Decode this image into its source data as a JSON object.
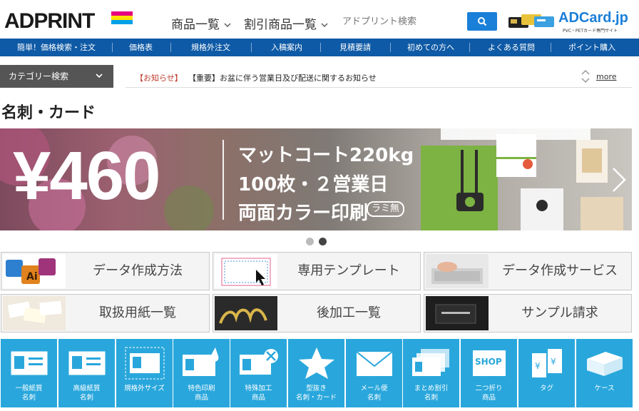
{
  "header": {
    "logo_text": "ADPRINT",
    "nav": [
      {
        "label": "商品一覧"
      },
      {
        "label": "割引商品一覧"
      }
    ],
    "search_placeholder": "アドプリント検索",
    "adcard_title": "ADCard.jp",
    "adcard_sub": "PVC・PETカード専門サイト",
    "logo_colors": [
      "#e6007e",
      "#ffe100",
      "#00a0e9"
    ]
  },
  "bluebar": {
    "items": [
      "簡単！価格検索・注文",
      "価格表",
      "規格外注文",
      "入稿案内",
      "見積要請",
      "初めての方へ",
      "よくある質問",
      "ポイント購入"
    ]
  },
  "category_search": "カテゴリー検索",
  "news": {
    "label": "【お知らせ】",
    "text": "【重要】お盆に伴う営業日及び配送に関するお知らせ",
    "more": "more"
  },
  "page_title": "名刺・カード",
  "banner": {
    "price": "¥460",
    "line1": "マットコート220kg",
    "line2": "100枚・２営業日",
    "line3": "両面カラー印刷",
    "badge": "ラミ無",
    "slide_count": 2,
    "active_slide": 2
  },
  "tiles": [
    {
      "label": "データ作成方法"
    },
    {
      "label": "専用テンプレート"
    },
    {
      "label": "データ作成サービス"
    },
    {
      "label": "取扱用紙一覧"
    },
    {
      "label": "後加工一覧"
    },
    {
      "label": "サンプル請求"
    }
  ],
  "categories": [
    {
      "label": "一般紙質\n名刺",
      "icon": "card-icon"
    },
    {
      "label": "高級紙質\n名刺",
      "icon": "card-icon"
    },
    {
      "label": "規格外サイズ",
      "icon": "card-crop-icon"
    },
    {
      "label": "特色印刷\n商品",
      "icon": "card-drop-icon"
    },
    {
      "label": "特殊加工\n商品",
      "icon": "card-tools-icon"
    },
    {
      "label": "型抜き\n名刺・カード",
      "icon": "star-icon"
    },
    {
      "label": "メール便\n名刺",
      "icon": "envelope-icon"
    },
    {
      "label": "まとめ割引\n名刺",
      "icon": "card-stack-icon"
    },
    {
      "label": "二つ折り\n商品",
      "icon": "shop-card-icon"
    },
    {
      "label": "タグ",
      "icon": "tag-icon"
    },
    {
      "label": "ケース",
      "icon": "box-icon"
    }
  ],
  "colors": {
    "brand_blue": "#0e5aa6",
    "accent_blue": "#1a7fd8",
    "category_blue": "#29a7dc",
    "notice_red": "#c0392b"
  }
}
